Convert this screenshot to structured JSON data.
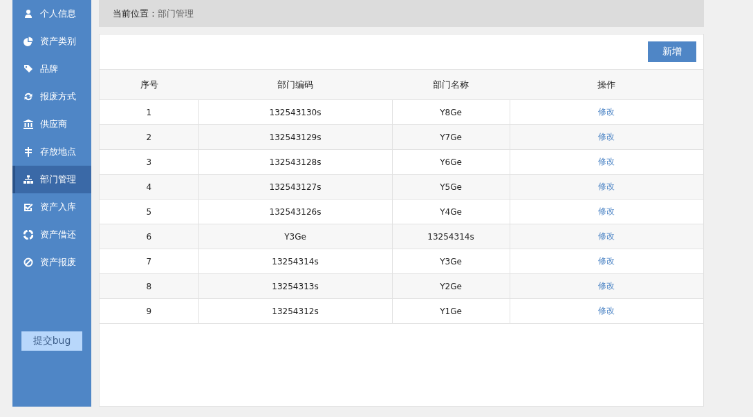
{
  "sidebar": {
    "items": [
      {
        "label": "个人信息",
        "selected": false
      },
      {
        "label": "资产类别",
        "selected": false
      },
      {
        "label": "品牌",
        "selected": false
      },
      {
        "label": "报废方式",
        "selected": false
      },
      {
        "label": "供应商",
        "selected": false
      },
      {
        "label": "存放地点",
        "selected": false
      },
      {
        "label": "部门管理",
        "selected": true
      },
      {
        "label": "资产入库",
        "selected": false
      },
      {
        "label": "资产借还",
        "selected": false
      },
      {
        "label": "资产报废",
        "selected": false
      }
    ],
    "bug_button": "提交bug"
  },
  "breadcrumb": {
    "label": "当前位置：",
    "current": "部门管理"
  },
  "toolbar": {
    "add_button": "新增"
  },
  "table": {
    "columns": [
      "序号",
      "部门编码",
      "部门名称",
      "操作"
    ],
    "rows": [
      [
        "1",
        "132543130s",
        "Y8Ge",
        "修改"
      ],
      [
        "2",
        "132543129s",
        "Y7Ge",
        "修改"
      ],
      [
        "3",
        "132543128s",
        "Y6Ge",
        "修改"
      ],
      [
        "4",
        "132543127s",
        "Y5Ge",
        "修改"
      ],
      [
        "5",
        "132543126s",
        "Y4Ge",
        "修改"
      ],
      [
        "6",
        "Y3Ge",
        "13254314s",
        "修改"
      ],
      [
        "7",
        "13254314s",
        "Y3Ge",
        "修改"
      ],
      [
        "8",
        "13254313s",
        "Y2Ge",
        "修改"
      ],
      [
        "9",
        "13254312s",
        "Y1Ge",
        "修改"
      ]
    ]
  }
}
